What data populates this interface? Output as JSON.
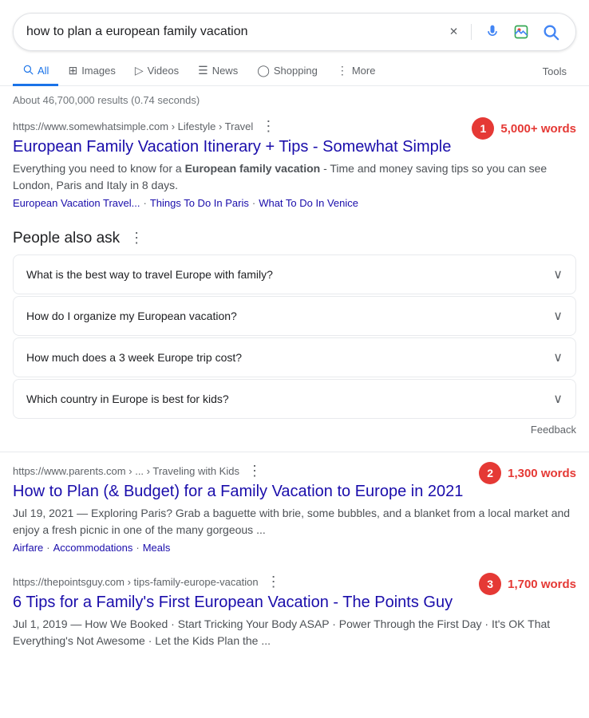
{
  "search": {
    "query": "how to plan a european family vacation",
    "placeholder": "Search"
  },
  "nav": {
    "tabs": [
      {
        "id": "all",
        "label": "All",
        "icon": "🔍",
        "active": true
      },
      {
        "id": "images",
        "label": "Images",
        "icon": "▦"
      },
      {
        "id": "videos",
        "label": "Videos",
        "icon": "▷"
      },
      {
        "id": "news",
        "label": "News",
        "icon": "📰"
      },
      {
        "id": "shopping",
        "label": "Shopping",
        "icon": "🛍"
      },
      {
        "id": "more",
        "label": "More",
        "icon": "⋮"
      }
    ],
    "tools_label": "Tools"
  },
  "results_info": "About 46,700,000 results (0.74 seconds)",
  "results": [
    {
      "id": "result-1",
      "url_domain": "https://www.somewhatsimple.com",
      "url_path": "Lifestyle › Travel",
      "title": "European Family Vacation Itinerary + Tips - Somewhat Simple",
      "description_parts": [
        "Everything you need to know for a ",
        "European family vacation",
        " - Time and money saving tips so you can see London, Paris and Italy in 8 days."
      ],
      "links": [
        "European Vacation Travel...",
        "Things To Do In Paris",
        "What To Do In Venice"
      ],
      "badge_number": "1",
      "badge_color": "#e53935",
      "badge_words": "5,000+ words",
      "badge_words_color": "#e53935"
    },
    {
      "id": "result-2",
      "url_domain": "https://www.parents.com",
      "url_path": "... › Traveling with Kids",
      "title": "How to Plan (& Budget) for a Family Vacation to Europe in 2021",
      "description": "Jul 19, 2021 — Exploring Paris? Grab a baguette with brie, some bubbles, and a blanket from a local market and enjoy a fresh picnic in one of the many gorgeous ...",
      "links": [
        "Airfare",
        "Accommodations",
        "Meals"
      ],
      "badge_number": "2",
      "badge_color": "#e53935",
      "badge_words": "1,300 words",
      "badge_words_color": "#e53935"
    },
    {
      "id": "result-3",
      "url_domain": "https://thepointsguy.com",
      "url_path": "tips-family-europe-vacation",
      "title": "6 Tips for a Family's First European Vacation - The Points Guy",
      "description": "Jul 1, 2019 — How We Booked · Start Tricking Your Body ASAP · Power Through the First Day · It's OK That Everything's Not Awesome · Let the Kids Plan the ...",
      "badge_number": "3",
      "badge_color": "#e53935",
      "badge_words": "1,700 words",
      "badge_words_color": "#e53935"
    }
  ],
  "paa": {
    "header": "People also ask",
    "questions": [
      "What is the best way to travel Europe with family?",
      "How do I organize my European vacation?",
      "How much does a 3 week Europe trip cost?",
      "Which country in Europe is best for kids?"
    ],
    "feedback_label": "Feedback"
  }
}
